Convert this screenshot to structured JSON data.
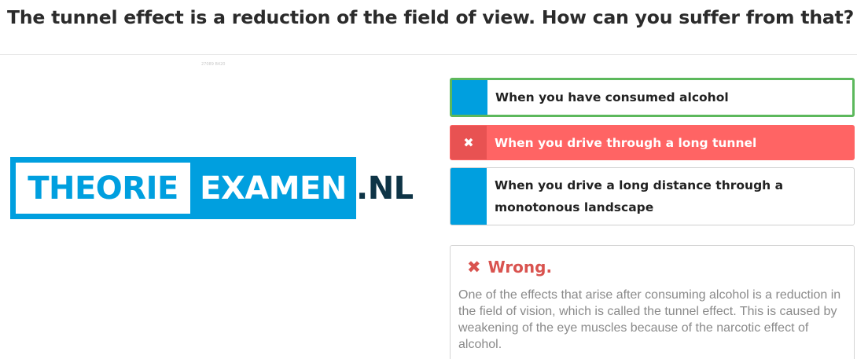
{
  "question": {
    "title": "The tunnel effect is a reduction of the field of view. How can you suffer from that?"
  },
  "image": {
    "caption": "27089 B420"
  },
  "logo": {
    "part1": "THEORIE",
    "part2": "EXAMEN",
    "part3": ".NL",
    "colors": {
      "blue": "#009fdf",
      "dark": "#0e3446"
    }
  },
  "answers": [
    {
      "label": "When you have consumed alcohol",
      "state": "correct"
    },
    {
      "label": "When you drive through a long tunnel",
      "state": "selected-wrong",
      "icon": "close-icon"
    },
    {
      "label": "When you drive a long distance through a monotonous landscape",
      "state": "neutral"
    }
  ],
  "feedback": {
    "icon": "close-icon",
    "title": "Wrong.",
    "text": "One of the effects that arise after consuming alcohol is a reduction in the field of vision, which is called the tunnel effect. This is caused by weakening of the eye muscles because of the narcotic effect of alcohol.",
    "color": "#d9534f"
  }
}
